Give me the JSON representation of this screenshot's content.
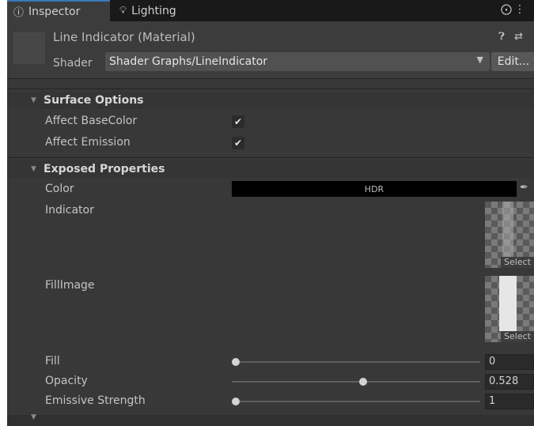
{
  "tabs": [
    {
      "icon": "info-icon",
      "label": "Inspector"
    },
    {
      "icon": "lightbulb-icon",
      "label": "Lighting"
    }
  ],
  "material": {
    "title": "Line Indicator (Material)",
    "shader_label": "Shader",
    "shader_value": "Shader Graphs/LineIndicator",
    "edit_label": "Edit..."
  },
  "surface_options": {
    "title": "Surface Options",
    "affect_basecolor": {
      "label": "Affect BaseColor",
      "checked": true
    },
    "affect_emission": {
      "label": "Affect Emission",
      "checked": true
    }
  },
  "exposed_properties": {
    "title": "Exposed Properties",
    "color": {
      "label": "Color",
      "badge": "HDR",
      "value": "#000000"
    },
    "indicator": {
      "label": "Indicator",
      "select_label": "Select"
    },
    "fillimage": {
      "label": "FillImage",
      "select_label": "Select"
    },
    "fill": {
      "label": "Fill",
      "value": "0",
      "level": 0
    },
    "opacity": {
      "label": "Opacity",
      "value": "0.528",
      "level": 0.528
    },
    "emissive_strength": {
      "label": "Emissive Strength",
      "value": "1",
      "level": 0
    }
  },
  "colors": {
    "panel_bg": "#383838",
    "tab_accent": "#3a79bb"
  }
}
